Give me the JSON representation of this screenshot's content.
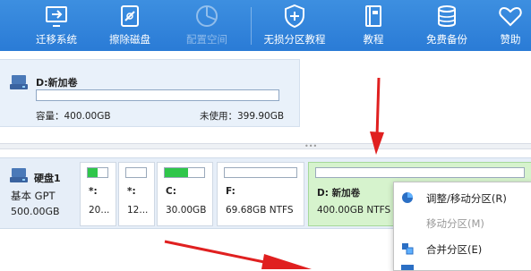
{
  "toolbar": {
    "buttons": [
      {
        "label": "迁移系统",
        "icon": "migrate-os-icon",
        "enabled": true
      },
      {
        "label": "擦除磁盘",
        "icon": "wipe-disk-icon",
        "enabled": true
      },
      {
        "label": "配置空间",
        "icon": "allocate-space-icon",
        "enabled": false
      },
      {
        "label": "无损分区教程",
        "icon": "shield-icon",
        "enabled": true
      },
      {
        "label": "教程",
        "icon": "book-icon",
        "enabled": true
      },
      {
        "label": "免费备份",
        "icon": "backup-icon",
        "enabled": true
      },
      {
        "label": "赞助",
        "icon": "heart-icon",
        "enabled": true
      }
    ]
  },
  "selected_volume": {
    "name": "D:新加卷",
    "capacity": "容量：400.00GB",
    "unused": "未使用：399.90GB"
  },
  "disk": {
    "name": "硬盘1",
    "type": "基本 GPT",
    "size": "500.00GB",
    "partitions": [
      {
        "label": "*:",
        "info": "20...",
        "usage": 0.5
      },
      {
        "label": "*:",
        "info": "12...",
        "usage": 0.0
      },
      {
        "label": "C:",
        "info": "30.00GB",
        "usage": 0.6
      },
      {
        "label": "F:",
        "info": "69.68GB NTFS",
        "usage": 0.0
      },
      {
        "label": "D: 新加卷",
        "info": "400.00GB NTFS",
        "usage": 0.0,
        "selected": true
      }
    ]
  },
  "context_menu": {
    "items": [
      {
        "label": "调整/移动分区(R)",
        "icon": "resize-partition-icon",
        "enabled": true
      },
      {
        "label": "移动分区(M)",
        "icon": "",
        "enabled": false
      },
      {
        "label": "合并分区(E)",
        "icon": "merge-partition-icon",
        "enabled": true
      }
    ]
  },
  "colors": {
    "toolbar": "#2a7bd6",
    "usage_fill": "#2fc64a",
    "selected_partition": "#d6f3cd",
    "annotation_arrow": "#e02020"
  }
}
